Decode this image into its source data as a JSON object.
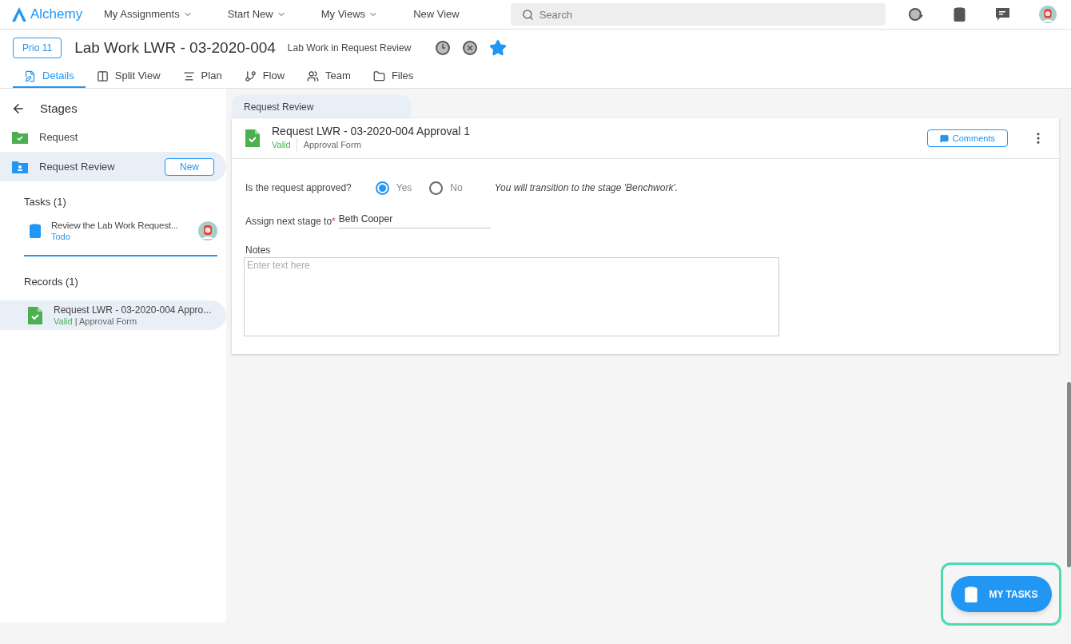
{
  "nav": {
    "logo": "Alchemy",
    "menus": [
      {
        "label": "My Assignments",
        "dropdown": true
      },
      {
        "label": "Start New",
        "dropdown": true
      },
      {
        "label": "My Views",
        "dropdown": true
      },
      {
        "label": "New View",
        "dropdown": false
      }
    ],
    "search": {
      "placeholder": "Search"
    }
  },
  "header": {
    "priority": "Prio 11",
    "title": "Lab Work LWR - 03-2020-004",
    "subtitle_prefix": "Lab Work in",
    "subtitle_stage": "Request Review",
    "favorite": true,
    "tabs": [
      {
        "label": "Details",
        "kind": "details",
        "selected": true
      },
      {
        "label": "Split View",
        "kind": "split",
        "selected": false
      },
      {
        "label": "Plan",
        "kind": "plan",
        "selected": false
      },
      {
        "label": "Flow",
        "kind": "flow",
        "selected": false
      },
      {
        "label": "Team",
        "kind": "team",
        "selected": false
      },
      {
        "label": "Files",
        "kind": "files",
        "selected": false
      }
    ]
  },
  "sidebar": {
    "title": "Stages",
    "stages": [
      {
        "label": "Request",
        "kind": "done",
        "selected": false
      },
      {
        "label": "Request Review",
        "kind": "current",
        "selected": true,
        "badge": "New"
      }
    ],
    "tasks_heading": "Tasks (1)",
    "tasks": [
      {
        "title": "Review the Lab Work Request...",
        "status": "Todo"
      }
    ],
    "records_heading": "Records (1)",
    "records": [
      {
        "title": "Request LWR - 03-2020-004 Appro...",
        "status": "Valid",
        "form": "| Approval Form",
        "selected": true
      }
    ]
  },
  "main": {
    "stage_tab": "Request Review",
    "record": {
      "title": "Request LWR - 03-2020-004 Approval 1",
      "status": "Valid",
      "form": "Approval Form",
      "comments": "Comments"
    },
    "question": {
      "label": "Is the request approved?",
      "options": [
        {
          "label": "Yes",
          "selected": true
        },
        {
          "label": "No",
          "selected": false
        }
      ],
      "hint": "You will transition to the stage 'Benchwork'."
    },
    "assign": {
      "label": "Assign next stage to",
      "required": "*",
      "value": "Beth Cooper"
    },
    "notes": {
      "label": "Notes",
      "placeholder": "Enter text here"
    }
  },
  "fab": {
    "label": "MY TASKS"
  }
}
